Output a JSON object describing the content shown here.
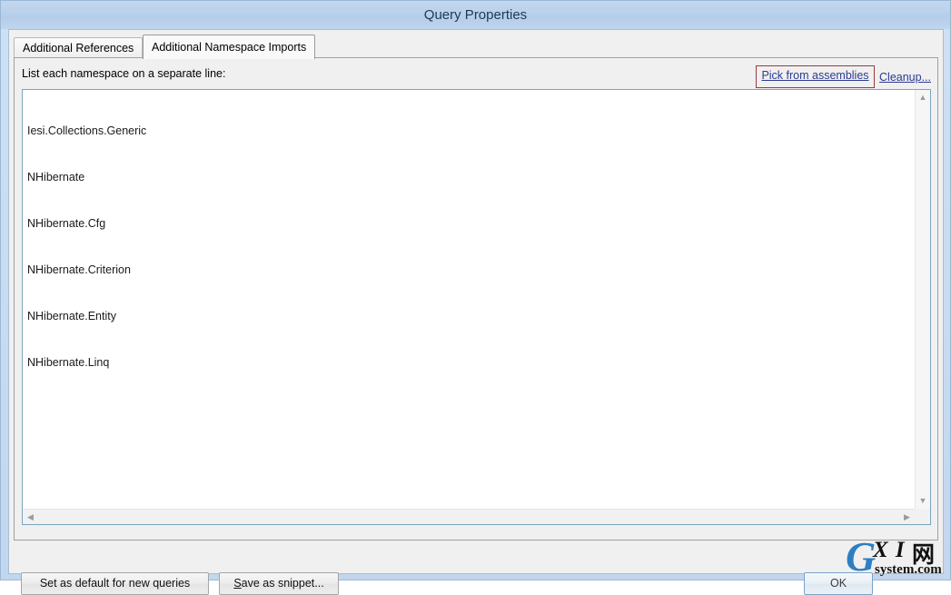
{
  "window": {
    "title": "Query Properties"
  },
  "tabs": [
    {
      "label": "Additional References",
      "active": false
    },
    {
      "label": "Additional Namespace Imports",
      "active": true
    }
  ],
  "panel": {
    "hint_label": "List each namespace on a separate line:",
    "links": {
      "pick_from_assemblies": "Pick from assemblies",
      "cleanup": "Cleanup...",
      "link_color": "#2b3b8f",
      "highlight_box_color": "#9a3b3b"
    }
  },
  "editor": {
    "namespaces": [
      "Iesi.Collections.Generic",
      "NHibernate",
      "NHibernate.Cfg",
      "NHibernate.Criterion",
      "NHibernate.Entity",
      "NHibernate.Linq"
    ],
    "vertical_scrollbar": {
      "up_arrow": "scroll-up-icon",
      "down_arrow": "scroll-down-icon"
    },
    "horizontal_scrollbar": {
      "left_arrow": "scroll-left-icon",
      "right_arrow": "scroll-right-icon"
    }
  },
  "footer": {
    "set_as_default": "Set as default for new queries",
    "save_as_snippet_accel": "S",
    "save_as_snippet_rest": "ave as snippet...",
    "ok": "OK"
  },
  "watermark": {
    "letter_g": "G",
    "letters_xi": "X I",
    "glyph_cn": "网",
    "site": "system.com",
    "color": "#2d7fc1"
  },
  "colors": {
    "titlebar": "#b9d0ea",
    "frame": "#c2d7ee",
    "client_bg": "#f0f0f0",
    "editor_border": "#7aa5bf"
  }
}
